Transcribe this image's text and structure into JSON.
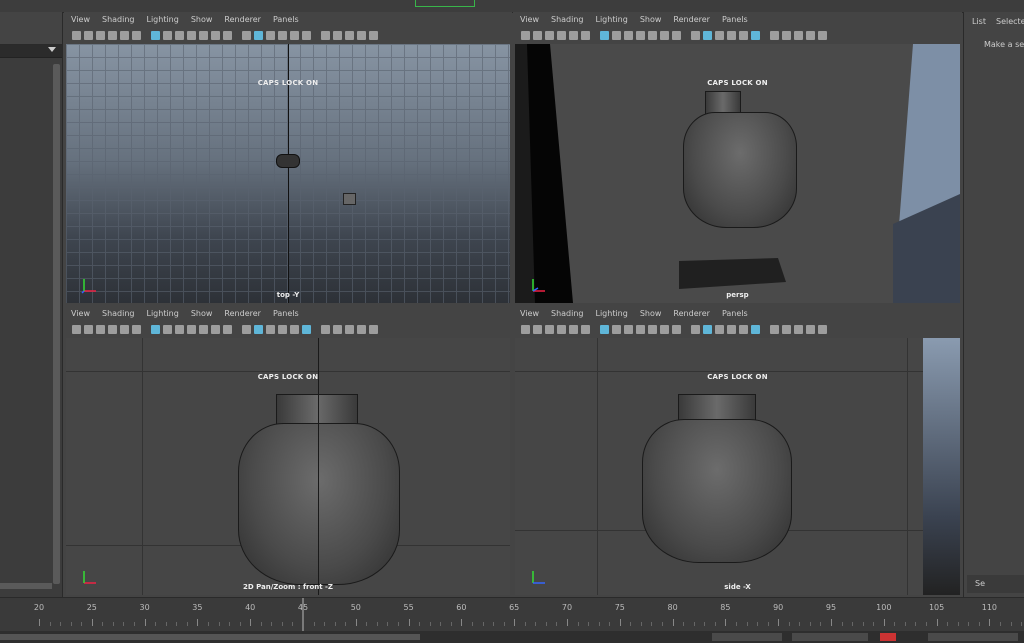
{
  "viewport_menu": [
    "View",
    "Shading",
    "Lighting",
    "Show",
    "Renderer",
    "Panels"
  ],
  "viewports": [
    {
      "id": "top",
      "camera_label": "top -Y",
      "overlay": "CAPS LOCK ON"
    },
    {
      "id": "persp",
      "camera_label": "persp",
      "overlay": "CAPS LOCK ON"
    },
    {
      "id": "front",
      "camera_label": "2D Pan/Zoom : front -Z",
      "overlay": "CAPS LOCK ON"
    },
    {
      "id": "side",
      "camera_label": "side -X",
      "overlay": "CAPS LOCK ON"
    }
  ],
  "right_panel": {
    "tabs": [
      "List",
      "Selecte"
    ],
    "message": "Make a se",
    "button": "Se"
  },
  "timeline": {
    "ticks": [
      "20",
      "25",
      "30",
      "35",
      "40",
      "45",
      "50",
      "55",
      "60",
      "65",
      "70",
      "75",
      "80",
      "85",
      "90",
      "95",
      "100",
      "105",
      "110"
    ]
  },
  "colors": {
    "accent": "#5fb6d8",
    "green": "#39b54a",
    "grid_sky": "#8794a3"
  }
}
